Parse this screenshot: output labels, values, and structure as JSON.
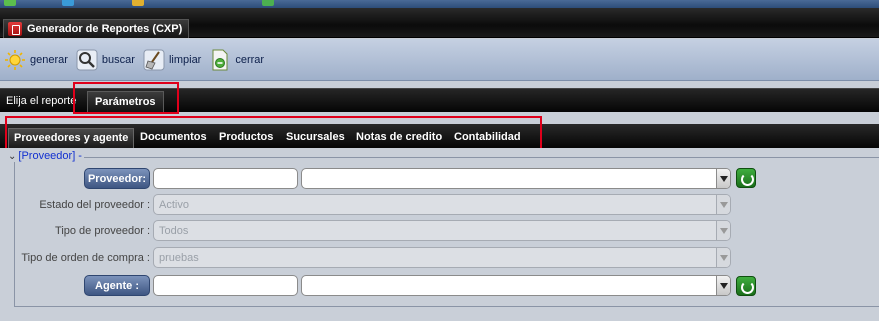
{
  "window": {
    "title": "Generador de Reportes (CXP)"
  },
  "toolbar": {
    "buttons": [
      {
        "label": "generar",
        "icon": "sun-icon"
      },
      {
        "label": "buscar",
        "icon": "magnifier-icon"
      },
      {
        "label": "limpiar",
        "icon": "broom-icon"
      },
      {
        "label": "cerrar",
        "icon": "document-close-icon"
      }
    ]
  },
  "report_bar": {
    "label": "Elija el reporte",
    "tab": "Parámetros"
  },
  "tabs": [
    "Proveedores y agente",
    "Documentos",
    "Productos",
    "Sucursales",
    "Notas de credito",
    "Contabilidad"
  ],
  "active_tab": "Proveedores y agente",
  "fieldset": {
    "legend": "[Proveedor] -",
    "proveedor": {
      "button": "Proveedor:",
      "value": "",
      "select_value": ""
    },
    "estado": {
      "label": "Estado del proveedor :",
      "value": "Activo"
    },
    "tipo": {
      "label": "Tipo de proveedor :",
      "value": "Todos"
    },
    "orden": {
      "label": "Tipo de orden de compra :",
      "value": "pruebas"
    },
    "agente": {
      "button": "Agente :",
      "value": "",
      "select_value": ""
    }
  },
  "colors": {
    "highlight": "#e0001b",
    "accent": "#3e5682",
    "legend": "#1230d0"
  }
}
